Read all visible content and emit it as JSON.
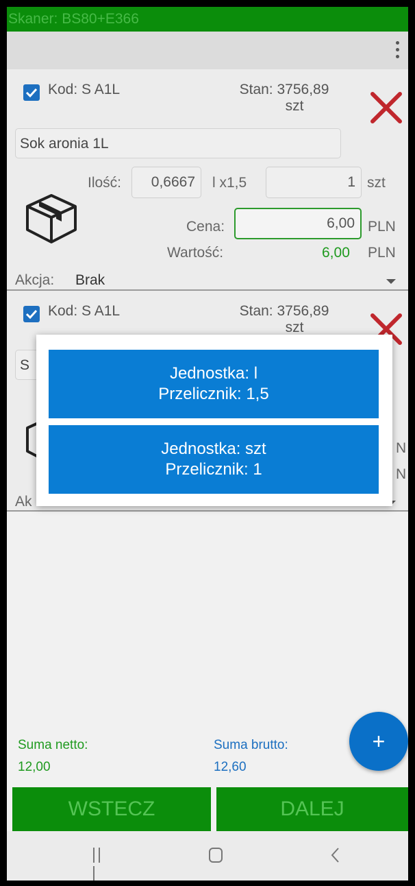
{
  "status_bar": {
    "text": "Skaner: BS80+E366"
  },
  "items": [
    {
      "kod": "Kod: S A1L",
      "stan_value": "Stan: 3756,89",
      "stan_unit": "szt",
      "name": "Sok aronia 1L",
      "ilosc_label": "Ilość:",
      "ilosc_value": "0,6667",
      "unit_conv": "l x1,5",
      "qty_value": "1",
      "qty_unit": "szt",
      "cena_label": "Cena:",
      "cena_value": "6,00",
      "cena_currency": "PLN",
      "wartosc_label": "Wartość:",
      "wartosc_value": "6,00",
      "wartosc_currency": "PLN",
      "akcja_label": "Akcja:",
      "akcja_value": "Brak"
    },
    {
      "kod": "Kod: S A1L",
      "stan_value": "Stan: 3756,89",
      "stan_unit": "szt",
      "name_partial": "S",
      "akcja_label_partial": "Ak",
      "cena_currency_partial": "N",
      "wartosc_currency_partial": "N"
    }
  ],
  "dialog": {
    "options": [
      {
        "line1": "Jednostka: l",
        "line2": "Przelicznik: 1,5"
      },
      {
        "line1": "Jednostka: szt",
        "line2": "Przelicznik: 1"
      }
    ]
  },
  "summary": {
    "netto_label": "Suma netto:",
    "netto_value": "12,00",
    "brutto_label": "Suma brutto:",
    "brutto_value": "12,60"
  },
  "fab": {
    "label": "+"
  },
  "buttons": {
    "back": "WSTECZ",
    "next": "DALEJ"
  },
  "colors": {
    "status_green": "#0b8d0b",
    "accent_blue": "#0a7dd4",
    "delete_red": "#c0272d",
    "value_green": "#1f9a1f"
  },
  "icons": [
    "checkbox-checked-icon",
    "delete-x-icon",
    "package-box-icon",
    "dropdown-arrow-icon",
    "more-vert-icon",
    "nav-recent-icon",
    "nav-home-icon",
    "nav-back-icon"
  ]
}
